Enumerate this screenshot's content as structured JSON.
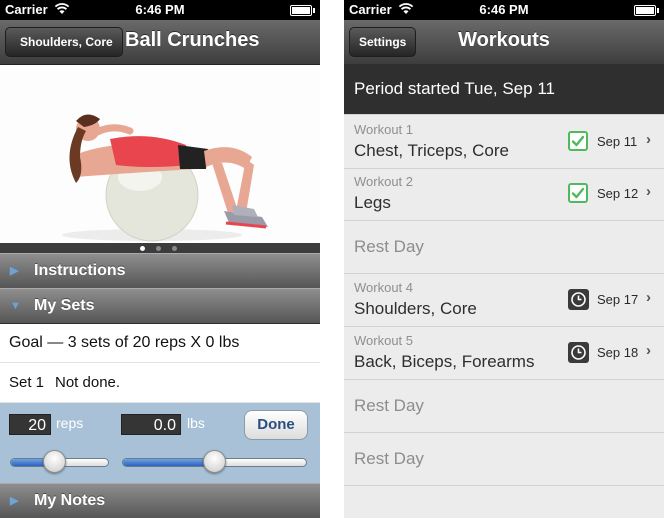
{
  "left": {
    "status": {
      "carrier": "Carrier",
      "time": "6:46 PM"
    },
    "nav": {
      "back_label": "Shoulders, Core",
      "title": "Ball Crunches"
    },
    "sections": {
      "instructions": "Instructions",
      "my_sets": "My Sets",
      "my_notes": "My Notes"
    },
    "goal": "Goal — 3 sets of 20 reps X 0 lbs",
    "set_row": {
      "label": "Set 1",
      "status": "Not done."
    },
    "editor": {
      "reps_value": "20",
      "reps_unit": "reps",
      "lbs_value": "0.0",
      "lbs_unit": "lbs",
      "done_label": "Done",
      "reps_slider_level": 0.45,
      "lbs_slider_level": 0.5
    },
    "pager": {
      "pages": 3,
      "current": 1
    }
  },
  "right": {
    "status": {
      "carrier": "Carrier",
      "time": "6:46 PM"
    },
    "nav": {
      "settings_label": "Settings",
      "title": "Workouts"
    },
    "period_text": "Period started Tue, Sep 11",
    "rows": [
      {
        "sub": "Workout 1",
        "name": "Chest, Triceps, Core",
        "date": "Sep 11",
        "status": "done"
      },
      {
        "sub": "Workout 2",
        "name": "Legs",
        "date": "Sep 12",
        "status": "done"
      },
      {
        "rest": "Rest Day"
      },
      {
        "sub": "Workout 4",
        "name": "Shoulders, Core",
        "date": "Sep 17",
        "status": "scheduled"
      },
      {
        "sub": "Workout 5",
        "name": "Back, Biceps, Forearms",
        "date": "Sep 18",
        "status": "scheduled"
      },
      {
        "rest": "Rest Day"
      },
      {
        "rest": "Rest Day"
      }
    ]
  },
  "colors": {
    "done_check": "#4dbb5c",
    "slider_fill": "#3a72d0",
    "done_text": "#2a4e80",
    "editor_bg": "#a8c1d7"
  },
  "icons": {
    "wifi": "wifi-icon",
    "battery": "battery-icon",
    "check": "checkmark-icon",
    "clock": "clock-icon",
    "chevron": "chevron-right-icon",
    "disclosure": "disclosure-triangle-icon"
  }
}
